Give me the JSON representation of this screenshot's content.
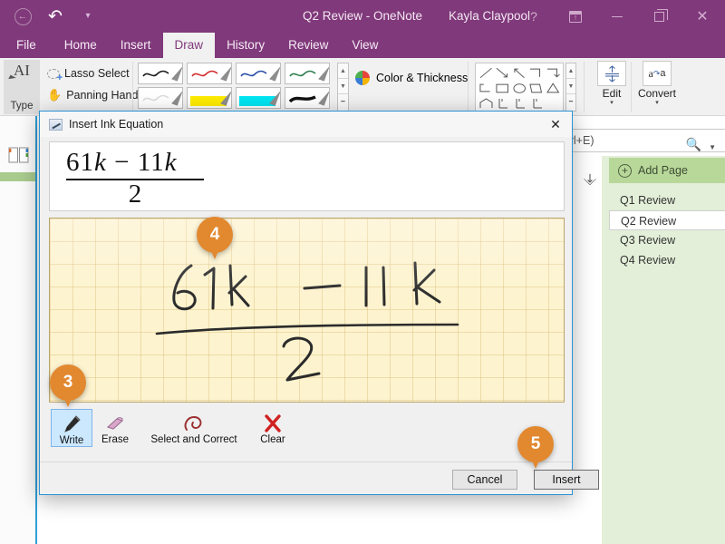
{
  "titlebar": {
    "back_icon": "back-arrow-icon",
    "undo_icon": "undo-icon",
    "qat_more_icon": "customize-quick-access-toolbar-icon",
    "document_title": "Q2 Review - OneNote",
    "user_name": "Kayla Claypool",
    "help_label": "?",
    "ribbon_display_icon": "ribbon-display-options-icon",
    "minimize_icon": "minimize-icon",
    "restore_icon": "restore-icon",
    "close_icon": "close-icon"
  },
  "tabs": [
    {
      "label": "File",
      "active": false
    },
    {
      "label": "Home",
      "active": false
    },
    {
      "label": "Insert",
      "active": false
    },
    {
      "label": "Draw",
      "active": true
    },
    {
      "label": "History",
      "active": false
    },
    {
      "label": "Review",
      "active": false
    },
    {
      "label": "View",
      "active": false
    }
  ],
  "ribbon": {
    "type_tool": {
      "label": "Type",
      "icon": "type-cursor-icon"
    },
    "lasso_select": {
      "label": "Lasso Select",
      "icon": "lasso-select-icon"
    },
    "panning_hand": {
      "label": "Panning Hand",
      "icon": "panning-hand-icon"
    },
    "pens": [
      {
        "name": "black-pen",
        "color": "#1a1a1a"
      },
      {
        "name": "red-pen",
        "color": "#d42b2b"
      },
      {
        "name": "blue-pen",
        "color": "#2a4fa8"
      },
      {
        "name": "green-pen",
        "color": "#2e7d4f"
      },
      {
        "name": "white-pen",
        "color": "#dcdcdc"
      },
      {
        "name": "yellow-highlighter",
        "color": "#ffec00"
      },
      {
        "name": "cyan-highlighter",
        "color": "#00e5f2"
      },
      {
        "name": "thick-black-pen",
        "color": "#111111"
      }
    ],
    "gallery_scroll": {
      "up": "▲",
      "down": "▼",
      "more": "▔"
    },
    "color_thickness": {
      "label": "Color & Thickness",
      "icon": "color-wheel-icon"
    },
    "shapes": [
      "diagonal-line",
      "arrow-down-right",
      "arrow-up-right",
      "corner-right",
      "corner-down",
      "elbow-arrow",
      "rectangle",
      "ellipse",
      "parallelogram",
      "triangle",
      "pentagon",
      "axis-1",
      "axis-2",
      "axis-3"
    ],
    "edit_button": {
      "label": "Edit",
      "icon": "insert-space-icon",
      "caret": "▾"
    },
    "convert_button": {
      "label": "Convert",
      "icon": "ink-to-text-icon",
      "caret": "▾"
    }
  },
  "app": {
    "notebook_icon": "notebook-icon",
    "search": {
      "placeholder": "Search (Ctrl+E)",
      "icon": "search-icon",
      "caret_icon": "chevron-down-icon"
    },
    "expand_icon": "expand-icon",
    "add_page": {
      "label": "Add Page",
      "icon": "plus-circle-icon"
    },
    "pages": [
      {
        "label": "Q1 Review",
        "selected": false
      },
      {
        "label": "Q2 Review",
        "selected": true
      },
      {
        "label": "Q3 Review",
        "selected": false
      },
      {
        "label": "Q4 Review",
        "selected": false
      }
    ]
  },
  "dialog": {
    "title": "Insert Ink Equation",
    "title_icon": "ink-equation-icon",
    "close_icon": "close-icon",
    "equation_preview": {
      "numerator_a": "61",
      "numerator_var_a": "k",
      "operator": "−",
      "numerator_b": "11",
      "numerator_var_b": "k",
      "denominator": "2",
      "plain_text": "(61k − 11k) / 2"
    },
    "ink_canvas": {
      "name": "ink-writing-area",
      "handwriting_text": "61k − 11k over 2",
      "ink_color": "#2b2b2b",
      "paper_color": "#fdf3cf",
      "grid_color": "#d8b86e"
    },
    "tools": [
      {
        "label": "Write",
        "icon": "pen-icon",
        "selected": true
      },
      {
        "label": "Erase",
        "icon": "eraser-icon",
        "selected": false
      },
      {
        "label": "Select and Correct",
        "icon": "lasso-correct-icon",
        "selected": false
      },
      {
        "label": "Clear",
        "icon": "red-x-icon",
        "selected": false
      }
    ],
    "buttons": {
      "cancel": "Cancel",
      "insert": "Insert"
    }
  },
  "callouts": [
    {
      "number": "3",
      "target": "write-tool"
    },
    {
      "number": "4",
      "target": "ink-canvas"
    },
    {
      "number": "5",
      "target": "insert-button"
    }
  ],
  "colors": {
    "brand_purple": "#80397b",
    "callout_orange": "#e2882f",
    "dialog_border_blue": "#2a94d6",
    "page_pane_green": "#e3efd8",
    "add_page_green": "#b8d89a",
    "selection_blue": "#cce8ff"
  }
}
